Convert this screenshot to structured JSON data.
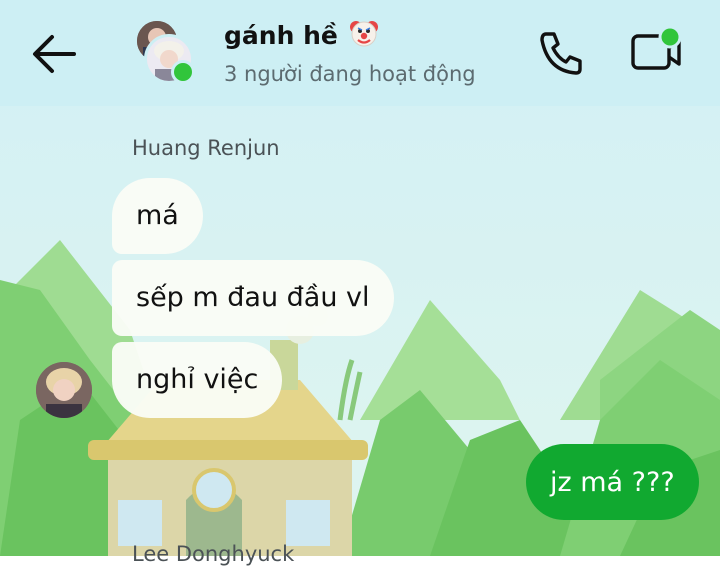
{
  "header": {
    "title": "gánh hề",
    "title_emoji": "clown-face",
    "subtitle": "3 người đang hoạt động",
    "online_color": "#31c53b"
  },
  "messages": [
    {
      "sender": "Huang Renjun",
      "bubbles": [
        "má",
        "sếp m đau đầu vl",
        "nghỉ việc"
      ]
    },
    {
      "sender": "me",
      "bubbles": [
        "jz má ???"
      ]
    }
  ],
  "next_sender": "Lee Donghyuck",
  "theme": {
    "header_bg": "#cdeff4",
    "sky": "#cdeff4",
    "tree": "#7fcf73",
    "my_bubble": "#11a930"
  }
}
